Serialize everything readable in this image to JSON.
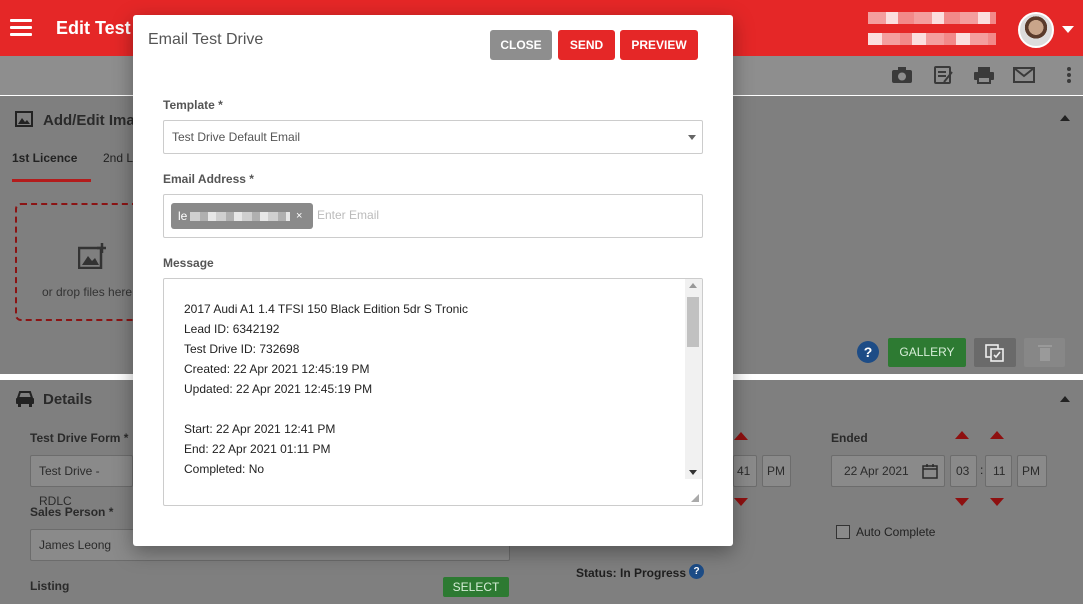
{
  "header": {
    "page_title": "Edit Test D",
    "menu_icon": "hamburger-icon",
    "user_name_blurred": "",
    "toolbar_icons": [
      "camera-icon",
      "notes-icon",
      "print-icon",
      "mail-icon",
      "more-vertical-icon"
    ]
  },
  "background": {
    "images_panel": {
      "title": "Add/Edit Images",
      "tabs": [
        "1st Licence",
        "2nd L"
      ],
      "drop_text": "or drop files here",
      "gallery_label": "GALLERY"
    },
    "details_panel": {
      "title": "Details",
      "test_drive_form_label": "Test Drive Form *",
      "test_drive_form_value": "Test Drive - RDLC",
      "sales_person_label": "Sales Person *",
      "sales_person_value": "James Leong",
      "listing_label": "Listing",
      "select_label": "SELECT",
      "ended_label": "Ended",
      "ended_date": "22 Apr 2021",
      "ended_hour": "03",
      "ended_minute": "11",
      "ended_ampm": "PM",
      "start_minute": "41",
      "start_ampm": "PM",
      "auto_complete_label": "Auto Complete",
      "status_text": "Status: In Progress"
    }
  },
  "modal": {
    "title": "Email Test Drive",
    "buttons": {
      "close": "CLOSE",
      "send": "SEND",
      "preview": "PREVIEW"
    },
    "template": {
      "label": "Template *",
      "value": "Test Drive Default Email"
    },
    "email": {
      "label": "Email Address *",
      "chip_prefix": "le",
      "chip_remove": "×",
      "placeholder": "Enter Email"
    },
    "message": {
      "label": "Message",
      "lines": [
        "2017 Audi A1 1.4 TFSI 150 Black Edition 5dr S Tronic",
        "Lead ID: 6342192",
        "Test Drive ID: 732698",
        "Created: 22 Apr 2021 12:45:19 PM",
        "Updated: 22 Apr 2021 12:45:19 PM",
        "",
        "Start: 22 Apr 2021 12:41 PM",
        "End: 22 Apr 2021 01:11 PM",
        "Completed: No"
      ]
    }
  },
  "colors": {
    "brand_red": "#e52727",
    "gallery_green": "#2d7a32",
    "close_grey": "#8e8e8e"
  }
}
